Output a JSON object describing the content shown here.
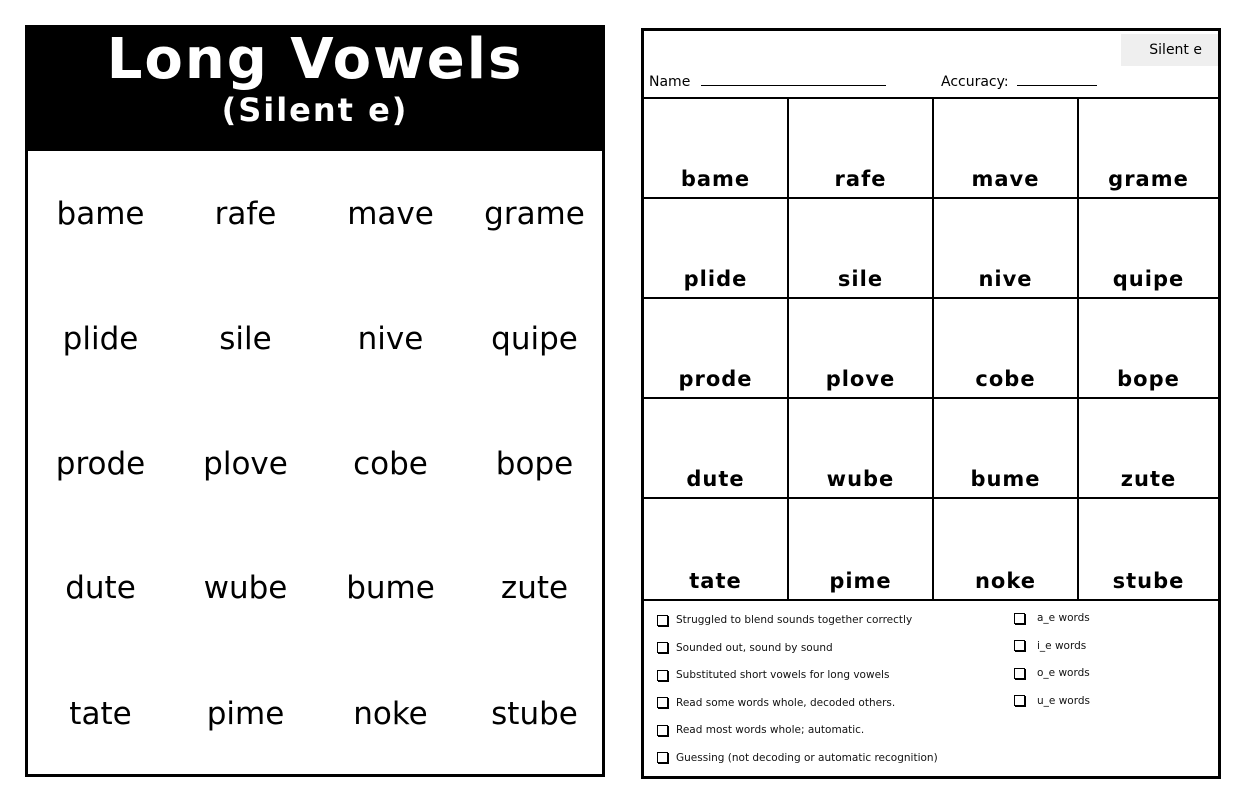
{
  "left_card": {
    "title": "Long Vowels",
    "subtitle": "(Silent e)",
    "rows": [
      [
        "bame",
        "rafe",
        "mave",
        "grame"
      ],
      [
        "plide",
        "sile",
        "nive",
        "quipe"
      ],
      [
        "prode",
        "plove",
        "cobe",
        "bope"
      ],
      [
        "dute",
        "wube",
        "bume",
        "zute"
      ],
      [
        "tate",
        "pime",
        "noke",
        "stube"
      ]
    ]
  },
  "right_card": {
    "tag": "Silent e",
    "name_label": "Name",
    "accuracy_label": "Accuracy:",
    "rows": [
      [
        "bame",
        "rafe",
        "mave",
        "grame"
      ],
      [
        "plide",
        "sile",
        "nive",
        "quipe"
      ],
      [
        "prode",
        "plove",
        "cobe",
        "bope"
      ],
      [
        "dute",
        "wube",
        "bume",
        "zute"
      ],
      [
        "tate",
        "pime",
        "noke",
        "stube"
      ]
    ],
    "observations": [
      "Struggled to blend sounds together correctly",
      "Sounded out, sound by sound",
      "Substituted short vowels for long vowels",
      "Read some words whole, decoded others.",
      "Read most words whole; automatic.",
      "Guessing (not decoding or automatic recognition)"
    ],
    "patterns": [
      "a_e words",
      "i_e words",
      "o_e words",
      "u_e words"
    ]
  }
}
